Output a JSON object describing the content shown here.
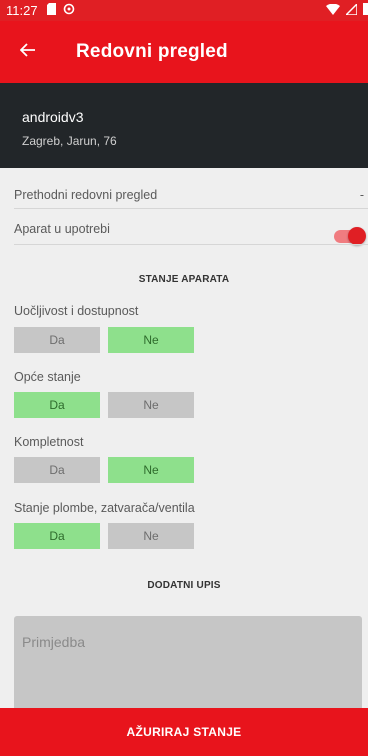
{
  "status_bar": {
    "time": "11:27"
  },
  "app_bar": {
    "title": "Redovni pregled"
  },
  "device": {
    "name": "androidv3",
    "address": "Zagreb, Jarun, 76"
  },
  "info": {
    "previous_label": "Prethodni redovni pregled",
    "previous_value": "-",
    "in_use_label": "Aparat u upotrebi",
    "in_use": true
  },
  "sections": {
    "state_heading": "STANJE APARATA",
    "extra_heading": "DODATNI UPIS"
  },
  "questions": [
    {
      "label": "Uočljivost i dostupnost",
      "yes": "Da",
      "no": "Ne",
      "selected": "no"
    },
    {
      "label": "Opće stanje",
      "yes": "Da",
      "no": "Ne",
      "selected": "yes"
    },
    {
      "label": "Kompletnost",
      "yes": "Da",
      "no": "Ne",
      "selected": "no"
    },
    {
      "label": "Stanje plombe, zatvarača/ventila",
      "yes": "Da",
      "no": "Ne",
      "selected": "yes"
    }
  ],
  "remark": {
    "placeholder": "Primjedba",
    "value": ""
  },
  "submit": {
    "label": "AŽURIRAJ STANJE"
  },
  "colors": {
    "accent": "#e8141c",
    "header_dark": "#222629",
    "selected_option": "#8ee08c",
    "neutral_option": "#c6c6c6"
  }
}
